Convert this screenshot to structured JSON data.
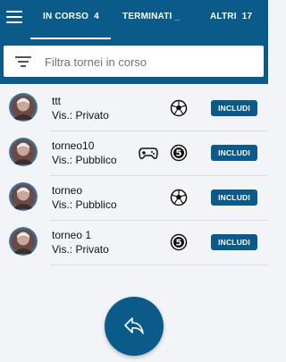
{
  "header": {
    "menu_icon": "hamburger-icon",
    "tabs": [
      {
        "label": "IN CORSO",
        "count": "4",
        "active": true
      },
      {
        "label": "TERMINATI _",
        "count": "",
        "active": false
      },
      {
        "label": "ALTRI",
        "count": "17",
        "active": false
      }
    ]
  },
  "search": {
    "icon": "filter-icon",
    "placeholder": "Filtra tornei in corso",
    "value": ""
  },
  "tournaments": [
    {
      "name": "ttt",
      "visibility": "Vis.: Privato",
      "icons": [
        "soccer-ball-icon"
      ],
      "button": "INCLUDI"
    },
    {
      "name": "torneo10",
      "visibility": "Vis.: Pubblico",
      "icons": [
        "gamepad-icon",
        "five-a-side-icon"
      ],
      "button": "INCLUDI"
    },
    {
      "name": "torneo",
      "visibility": "Vis.: Pubblico",
      "icons": [
        "soccer-ball-icon"
      ],
      "button": "INCLUDI"
    },
    {
      "name": "torneo 1",
      "visibility": "Vis.: Privato",
      "icons": [
        "five-a-side-icon"
      ],
      "button": "INCLUDI"
    }
  ],
  "fab": {
    "icon": "reply-icon"
  },
  "colors": {
    "primary": "#0a5a8a",
    "background": "#f3f4f8"
  }
}
